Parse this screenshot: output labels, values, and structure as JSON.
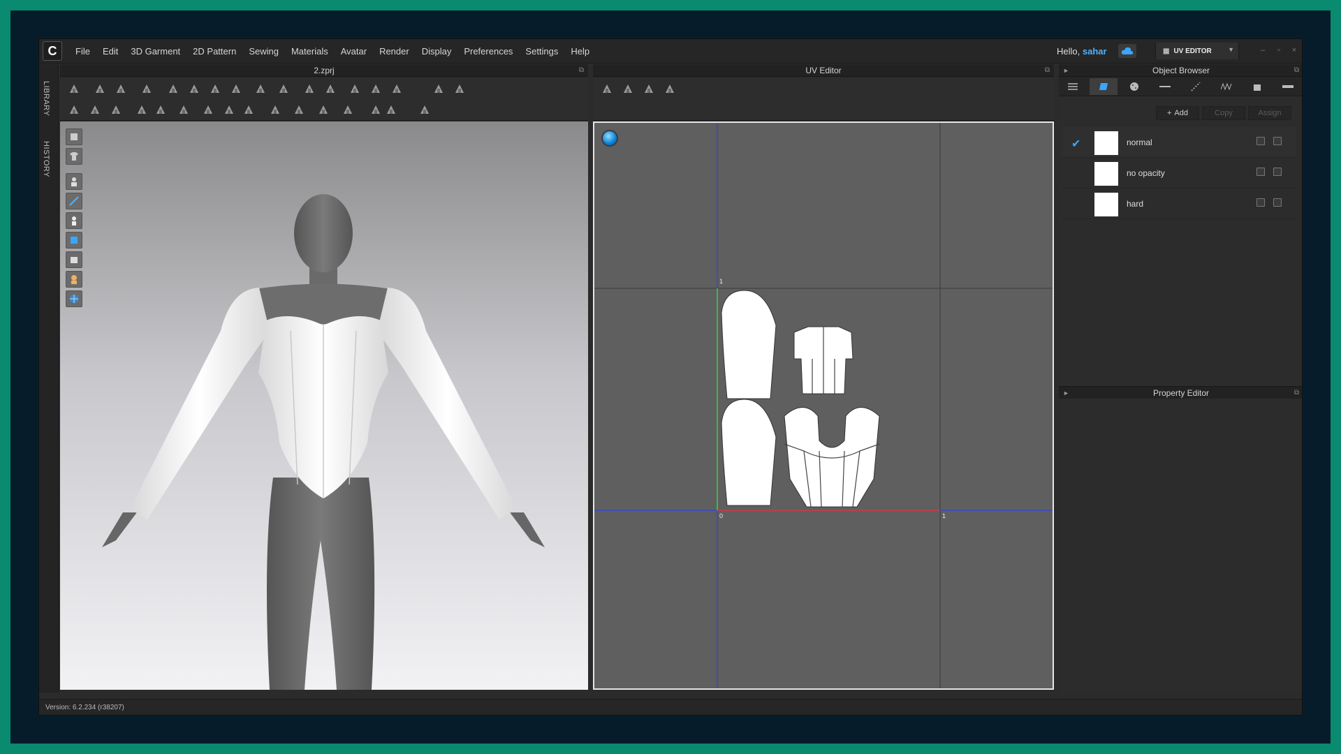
{
  "menubar": {
    "items": [
      "File",
      "Edit",
      "3D Garment",
      "2D Pattern",
      "Sewing",
      "Materials",
      "Avatar",
      "Render",
      "Display",
      "Preferences",
      "Settings",
      "Help"
    ],
    "greeting": "Hello,",
    "username": "sahar",
    "mode_label": "UV EDITOR"
  },
  "side_tabs": {
    "library": "LIBRARY",
    "history": "HISTORY"
  },
  "viewport3d": {
    "title": "2.zprj"
  },
  "uv_editor": {
    "title": "UV Editor",
    "axis_labels": {
      "top_one": "1",
      "origin": "0",
      "right_one": "1"
    }
  },
  "object_browser": {
    "title": "Object Browser",
    "actions": {
      "add": "Add",
      "copy": "Copy",
      "assign": "Assign"
    },
    "materials": [
      {
        "name": "normal",
        "selected": true
      },
      {
        "name": "no opacity",
        "selected": false
      },
      {
        "name": "hard",
        "selected": false
      }
    ]
  },
  "property_editor": {
    "title": "Property Editor"
  },
  "status": {
    "version": "Version: 6.2.234 (r38207)"
  },
  "colors": {
    "accent": "#35a8ff",
    "frame": "#0a8a6e",
    "uv_u_axis": "#d43a3a",
    "uv_v_axis": "#3bd43b",
    "uv_grid_axis": "#3344dd"
  }
}
